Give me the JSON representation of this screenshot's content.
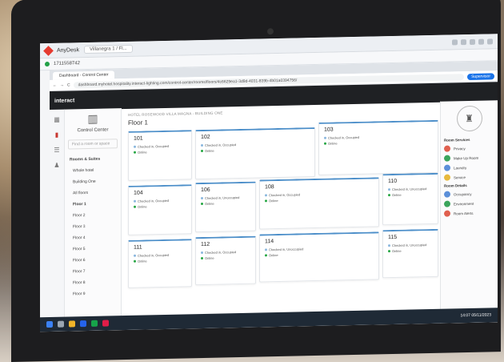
{
  "anydesk": {
    "app_name": "AnyDesk",
    "tab": "Villanegra 1 / Fl...",
    "session_id": "1711558742"
  },
  "browser": {
    "tab_title": "Dashboard - Control Center",
    "url": "dashboard.myhotel.hospitality.interact-lighting.com/control-center/rooms/floors/4c6629ea1-3d9d-4031-839b-4b01a0394756/"
  },
  "app": {
    "name": "interact",
    "profile": "Supervisor"
  },
  "sidebar": {
    "title": "Control Center",
    "search_placeholder": "Find a room or space",
    "items": [
      {
        "label": "Rooms & Suites"
      },
      {
        "label": "Whole hotel"
      },
      {
        "label": "Building One"
      },
      {
        "label": "All floors"
      },
      {
        "label": "Floor 1"
      },
      {
        "label": "Floor 2"
      },
      {
        "label": "Floor 3"
      },
      {
        "label": "Floor 4"
      },
      {
        "label": "Floor 5"
      },
      {
        "label": "Floor 6"
      },
      {
        "label": "Floor 7"
      },
      {
        "label": "Floor 8"
      },
      {
        "label": "Floor 9"
      }
    ]
  },
  "main": {
    "breadcrumb": "HOTEL ROSEWOOD VILLA MAGNA - BUILDING ONE",
    "floor_title": "Floor 1",
    "rooms": [
      {
        "number": "101",
        "status": "Checked in, Occupied",
        "online": "Online"
      },
      {
        "number": "102",
        "status": "Checked in, Occupied",
        "online": "Online"
      },
      {
        "number": "103",
        "status": "Checked in, Occupied",
        "online": "Online"
      },
      {
        "number": "104",
        "status": "Checked in, Occupied",
        "online": "Online"
      },
      {
        "number": "106",
        "status": "Checked in, Unoccupied",
        "online": "Online"
      },
      {
        "number": "108",
        "status": "Checked in, Occupied",
        "online": "Online"
      },
      {
        "number": "110",
        "status": "Checked in, Unoccupied",
        "online": "Online"
      },
      {
        "number": "111",
        "status": "Checked in, Occupied",
        "online": "Online"
      },
      {
        "number": "112",
        "status": "Checked in, Occupied",
        "online": "Online"
      },
      {
        "number": "114",
        "status": "Checked in, Unoccupied",
        "online": "Online"
      },
      {
        "number": "115",
        "status": "Checked in, Unoccupied",
        "online": "Online"
      }
    ]
  },
  "right_panel": {
    "services_heading": "Room Services",
    "services": [
      {
        "label": "Privacy",
        "color": "#e0604f"
      },
      {
        "label": "Make Up Room",
        "color": "#3ba55c"
      },
      {
        "label": "Laundry",
        "color": "#5b8fd9"
      },
      {
        "label": "Service",
        "color": "#e7b93c"
      }
    ],
    "details_heading": "Room Details",
    "details": [
      {
        "label": "Occupancy",
        "color": "#5b8fd9"
      },
      {
        "label": "Environment",
        "color": "#3ba55c"
      },
      {
        "label": "Room Alerts",
        "color": "#e0604f"
      }
    ]
  },
  "taskbar": {
    "time": "14:07",
    "date": "05/11/2023"
  }
}
